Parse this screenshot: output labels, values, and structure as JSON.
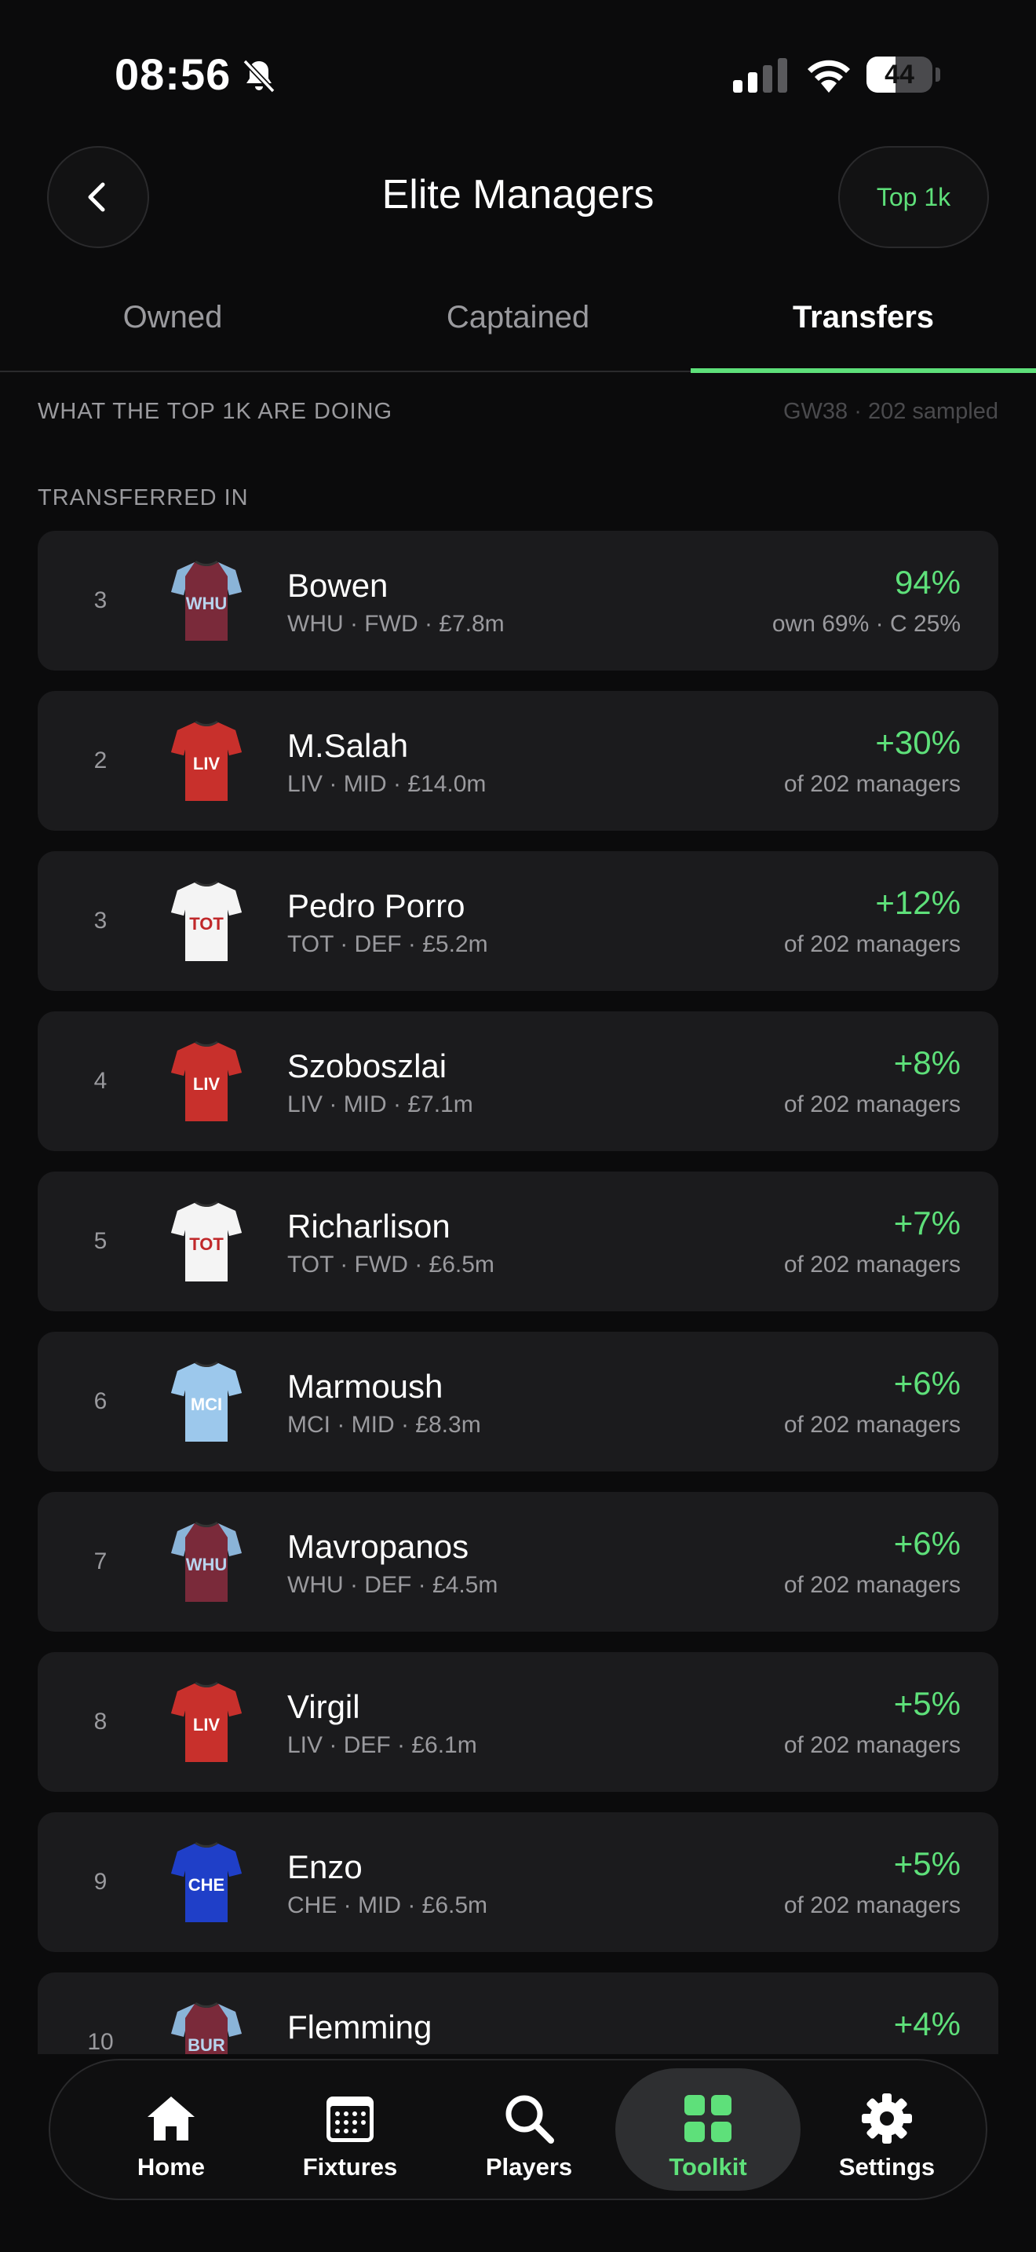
{
  "status": {
    "time": "08:56",
    "battery": "44",
    "battery_level": 0.44
  },
  "header": {
    "title": "Elite Managers",
    "pill_label": "Top 1k"
  },
  "tabs": [
    {
      "label": "Owned"
    },
    {
      "label": "Captained"
    },
    {
      "label": "Transfers"
    }
  ],
  "active_tab": "Transfers",
  "section": {
    "heading": "WHAT THE TOP 1K ARE DOING",
    "meta": "GW38 · 202 sampled"
  },
  "subheading": "TRANSFERRED IN",
  "colors": {
    "accent": "#5ee07a",
    "card_bg": "#1b1b1d",
    "page_bg": "#0b0b0c"
  },
  "rows": [
    {
      "rank": "3",
      "team": "WHU",
      "name": "Bowen",
      "meta": "WHU · FWD · £7.8m",
      "pct": "94%",
      "sub": "own 69% · C 25%"
    },
    {
      "rank": "2",
      "team": "LIV",
      "name": "M.Salah",
      "meta": "LIV · MID · £14.0m",
      "pct": "+30%",
      "sub": "of 202 managers"
    },
    {
      "rank": "3",
      "team": "TOT",
      "name": "Pedro Porro",
      "meta": "TOT · DEF · £5.2m",
      "pct": "+12%",
      "sub": "of 202 managers"
    },
    {
      "rank": "4",
      "team": "LIV",
      "name": "Szoboszlai",
      "meta": "LIV · MID · £7.1m",
      "pct": "+8%",
      "sub": "of 202 managers"
    },
    {
      "rank": "5",
      "team": "TOT",
      "name": "Richarlison",
      "meta": "TOT · FWD · £6.5m",
      "pct": "+7%",
      "sub": "of 202 managers"
    },
    {
      "rank": "6",
      "team": "MCI",
      "name": "Marmoush",
      "meta": "MCI · MID · £8.3m",
      "pct": "+6%",
      "sub": "of 202 managers"
    },
    {
      "rank": "7",
      "team": "WHU",
      "name": "Mavropanos",
      "meta": "WHU · DEF · £4.5m",
      "pct": "+6%",
      "sub": "of 202 managers"
    },
    {
      "rank": "8",
      "team": "LIV",
      "name": "Virgil",
      "meta": "LIV · DEF · £6.1m",
      "pct": "+5%",
      "sub": "of 202 managers"
    },
    {
      "rank": "9",
      "team": "CHE",
      "name": "Enzo",
      "meta": "CHE · MID · £6.5m",
      "pct": "+5%",
      "sub": "of 202 managers"
    },
    {
      "rank": "10",
      "team": "BUR",
      "name": "Flemming",
      "meta": "",
      "pct": "+4%",
      "sub": ""
    }
  ],
  "team_colors": {
    "WHU": {
      "body": "#7a2a3a",
      "sleeve": "#8ab4d8",
      "text": "#b8d4ee"
    },
    "LIV": {
      "body": "#c8302c",
      "sleeve": "#c8302c",
      "text": "#ffffff"
    },
    "TOT": {
      "body": "#f4f4f4",
      "sleeve": "#f4f4f4",
      "text": "#c0282a"
    },
    "MCI": {
      "body": "#9cc8ec",
      "sleeve": "#9cc8ec",
      "text": "#ffffff"
    },
    "CHE": {
      "body": "#1f3fc8",
      "sleeve": "#1f3fc8",
      "text": "#ffffff"
    },
    "BUR": {
      "body": "#7a2a3a",
      "sleeve": "#8ab4d8",
      "text": "#b8d4ee"
    }
  },
  "nav": [
    {
      "label": "Home",
      "icon": "home-icon"
    },
    {
      "label": "Fixtures",
      "icon": "calendar-icon"
    },
    {
      "label": "Players",
      "icon": "search-icon"
    },
    {
      "label": "Toolkit",
      "icon": "grid-icon"
    },
    {
      "label": "Settings",
      "icon": "gear-icon"
    }
  ],
  "active_nav": "Toolkit"
}
